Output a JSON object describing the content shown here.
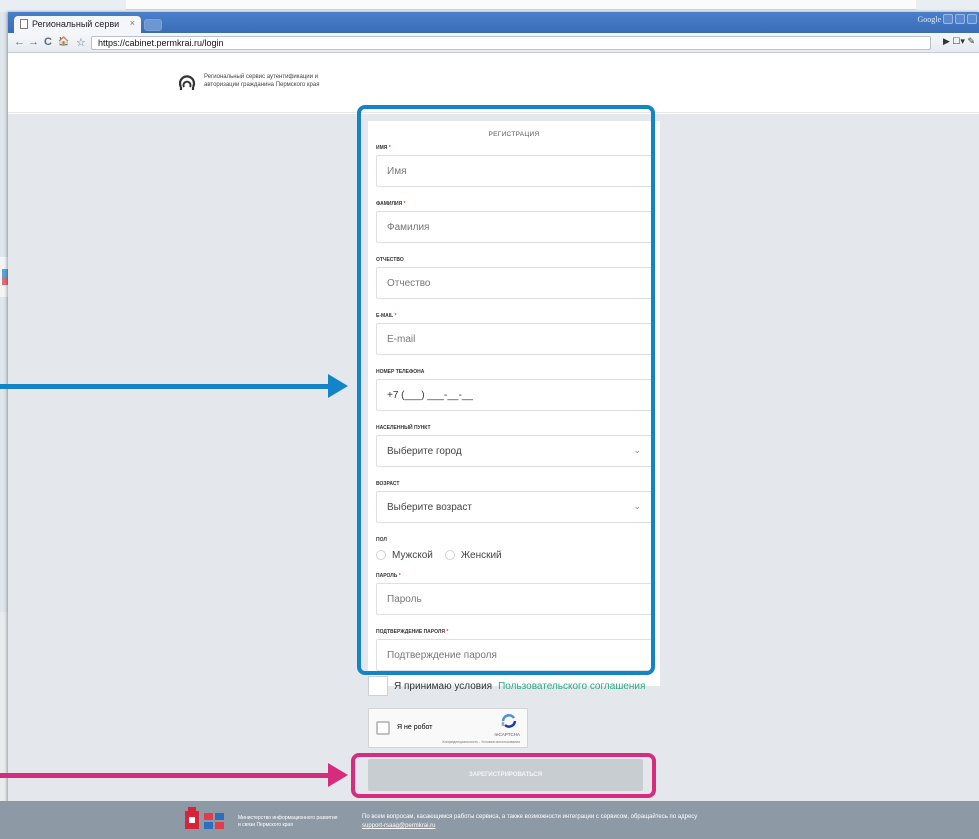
{
  "browser": {
    "tab_title": "Региональный серви",
    "tab_close": "×",
    "google_label": "Google",
    "address": "https://cabinet.permkrai.ru/login",
    "nav_back": "←",
    "nav_forward": "→",
    "nav_reload": "C",
    "nav_home": "🏠",
    "star": "☆",
    "tools": "▶  ☐▾ ✎"
  },
  "header": {
    "logo_text": "Региональный сервис аутентификации и авторизации гражданина Пермского края"
  },
  "form": {
    "title": "РЕГИСТРАЦИЯ",
    "first_name_label": "ИМЯ",
    "first_name_placeholder": "Имя",
    "last_name_label": "ФАМИЛИЯ",
    "last_name_placeholder": "Фамилия",
    "patronymic_label": "ОТЧЕСТВО",
    "patronymic_placeholder": "Отчество",
    "email_label": "E-MAIL",
    "email_placeholder": "E-mail",
    "phone_label": "НОМЕР ТЕЛЕФОНА",
    "phone_placeholder": "+7 (___) ___-__-__",
    "city_label": "НАСЕЛЕННЫЙ ПУНКТ",
    "city_value": "Выберите город",
    "age_label": "ВОЗРАСТ",
    "age_value": "Выберите возраст",
    "gender_label": "ПОЛ",
    "gender_male": "Мужской",
    "gender_female": "Женский",
    "password_label": "ПАРОЛЬ",
    "password_placeholder": "Пароль",
    "confirm_label": "ПОДТВЕРЖДЕНИЕ ПАРОЛЯ",
    "confirm_placeholder": "Подтверждение пароля",
    "required_mark": "*",
    "agree_text": "Я принимаю условия",
    "agree_link": "Пользовательского соглашения",
    "captcha_label": "Я не робот",
    "captcha_brand": "reCAPTCHA",
    "captcha_terms": "Конфиденциальность - Условия использования",
    "submit_label": "ЗАРЕГИСТРИРОВАТЬСЯ"
  },
  "footer": {
    "ministry": "Министерство информационного развития и связи Пермского края",
    "info": "По всем вопросам, касающимся работы сервиса, а также возможности интеграции с сервисом, обращайтесь по адресу",
    "email": "support-rsaag@permkrai.ru"
  },
  "colors": {
    "highlight_blue": "#1484c8",
    "highlight_pink": "#d72b7e",
    "link_green": "#2aa881",
    "footer_bg": "#8d9aa6"
  }
}
